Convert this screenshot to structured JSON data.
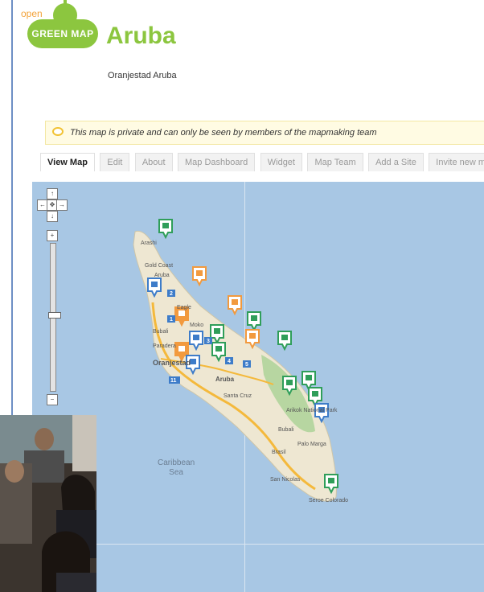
{
  "logo": {
    "open": "open",
    "badge": "GREEN MAP"
  },
  "header": {
    "title": "Aruba",
    "subtitle": "Oranjestad Aruba"
  },
  "notice": {
    "text": "This map is private and can only be seen by members of the mapmaking team"
  },
  "tabs": [
    {
      "label": "View Map",
      "active": true
    },
    {
      "label": "Edit"
    },
    {
      "label": "About"
    },
    {
      "label": "Map Dashboard"
    },
    {
      "label": "Widget"
    },
    {
      "label": "Map Team"
    },
    {
      "label": "Add a Site"
    },
    {
      "label": "Invite new mem"
    }
  ],
  "map": {
    "sea_label_1": "Caribbean",
    "sea_label_2": "Sea",
    "places": [
      "Arashi",
      "Gold Coast",
      "Aruba",
      "Eagle",
      "Moko",
      "Bubali",
      "Paradera",
      "Oranjestad",
      "Aruba",
      "Santa Cruz",
      "Arikok National Park",
      "Bubali",
      "Palo Marga",
      "Brasil",
      "San Nicolas",
      "Seroe Colorado"
    ],
    "road_labels": [
      "1",
      "2",
      "3",
      "4",
      "5",
      "11"
    ],
    "colors": {
      "sea": "#a8c7e4",
      "land": "#eee7d2",
      "park": "#b7d6a1",
      "road": "#f4b93c",
      "marker_green": "#2f9e59",
      "marker_orange": "#f29a3e",
      "marker_blue": "#3d7cc9"
    }
  },
  "photo": {
    "description": ""
  }
}
